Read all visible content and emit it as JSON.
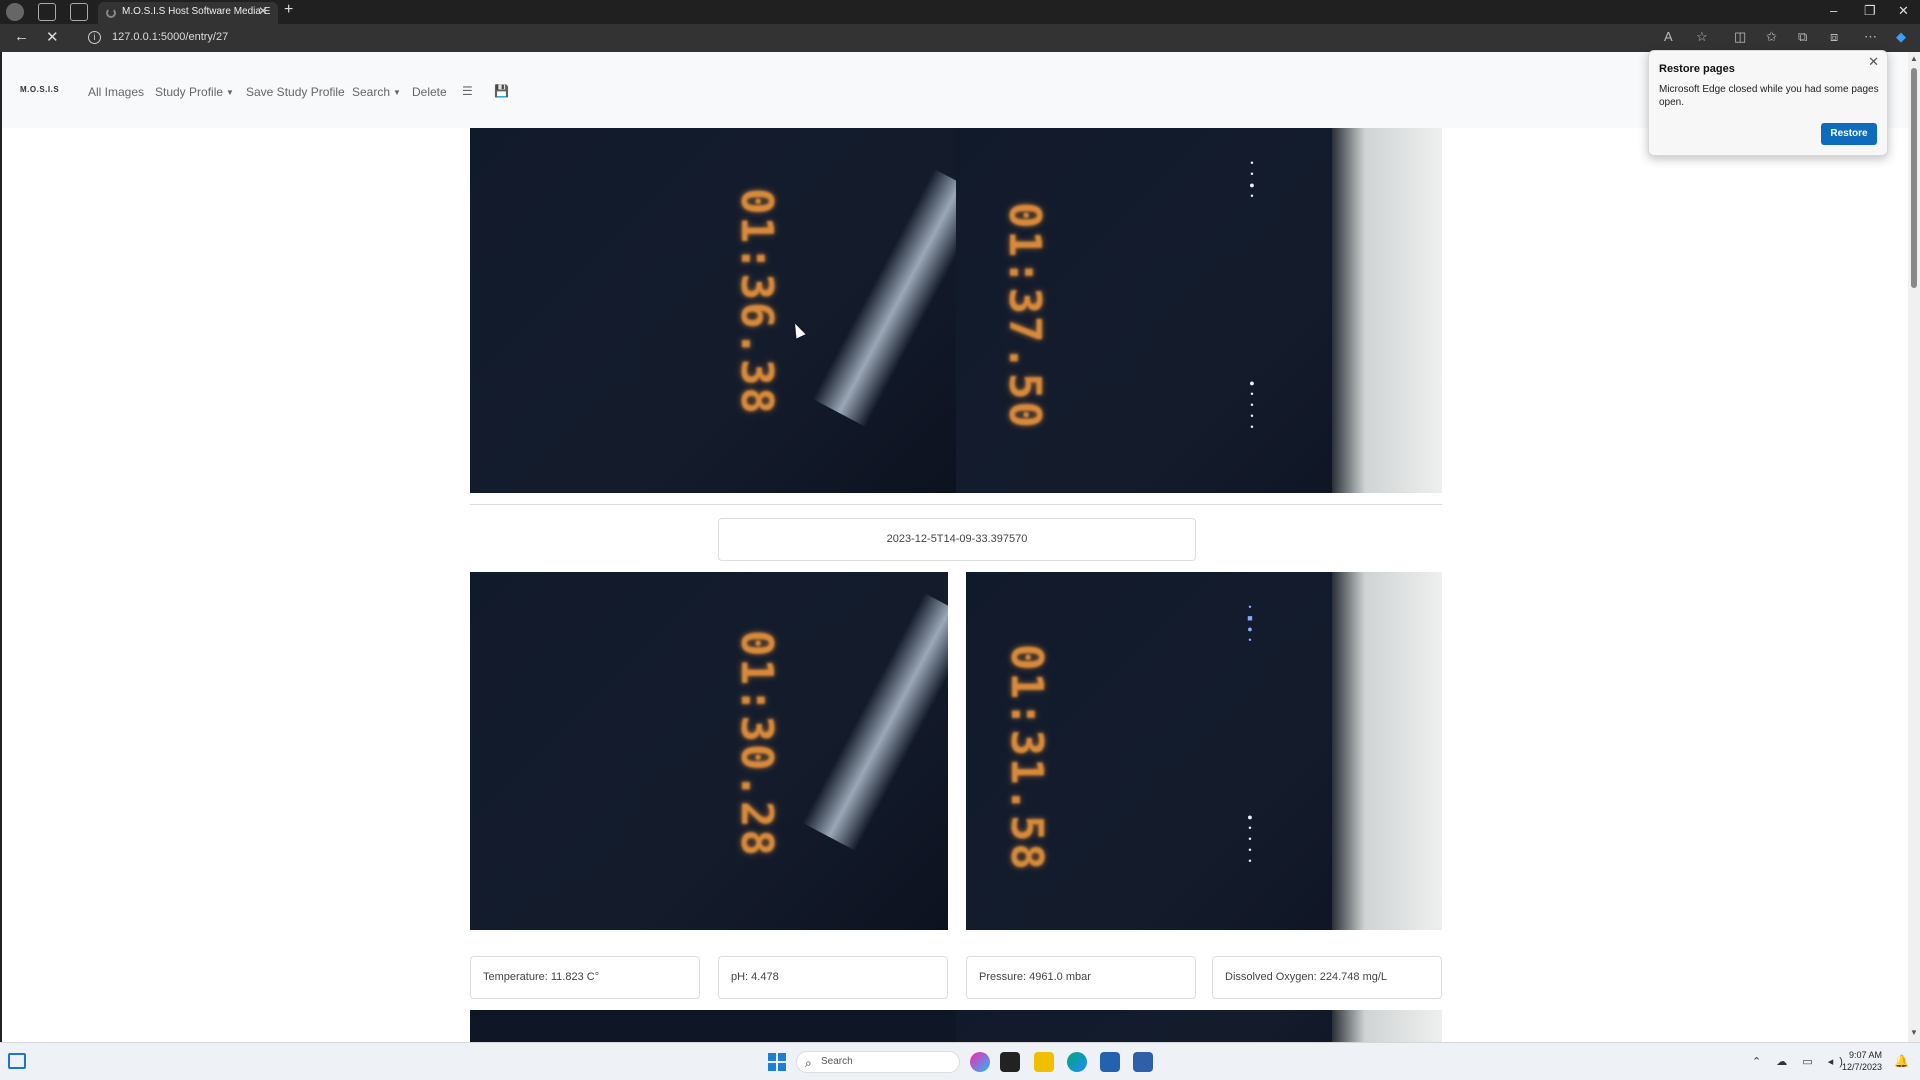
{
  "browser": {
    "tab_title": "M.O.S.I.S Host Software Media E",
    "url": "127.0.0.1:5000/entry/27"
  },
  "navbar": {
    "brand": "M.O.S.I.S",
    "all_images": "All Images",
    "study_profile": "Study Profile",
    "save_study_profile": "Save Study Profile",
    "search": "Search",
    "delete": "Delete",
    "icons": [
      "list-icon",
      "save-icon"
    ]
  },
  "entry": {
    "images_top": {
      "left_ts": "01:36.38",
      "right_ts": "01:37.50"
    },
    "timestamp": "2023-12-5T14-09-33.397570",
    "images_bottom": {
      "left_ts": "01:30.28",
      "right_ts": "01:31.58"
    },
    "readings": {
      "temperature": "Temperature: 11.823 C°",
      "ph": "pH: 4.478",
      "pressure": "Pressure: 4961.0 mbar",
      "dissolved_oxygen": "Dissolved Oxygen: 224.748 mg/L"
    }
  },
  "restore_popup": {
    "title": "Restore pages",
    "message": "Microsoft Edge closed while you had some pages open.",
    "button": "Restore"
  },
  "taskbar": {
    "search": "Search",
    "time": "9:07 AM",
    "date": "12/7/2023"
  },
  "colors": {
    "accent": "#0f6cbd",
    "timestamp_orange": "#d88a3a"
  }
}
